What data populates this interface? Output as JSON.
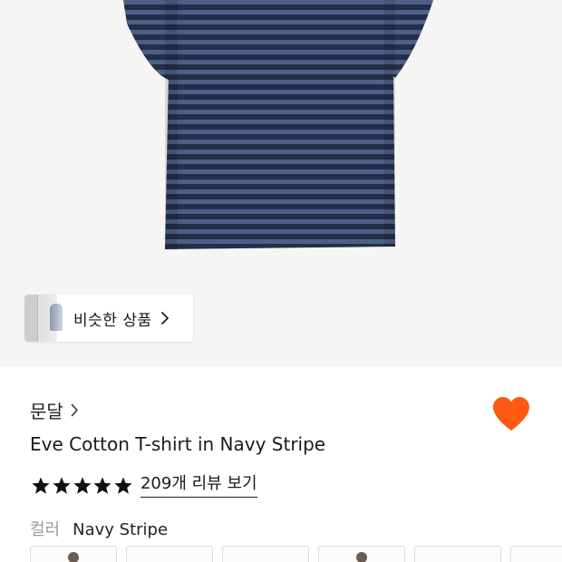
{
  "similar": {
    "label": "비슷한 상품"
  },
  "product": {
    "brand": "문달",
    "title": "Eve Cotton T-shirt in Navy Stripe",
    "favorited": true,
    "accent_color": "#fe5a12",
    "rating": {
      "stars": 5,
      "reviews_label": "209개 리뷰 보기"
    },
    "color": {
      "label": "컬러",
      "value": "Navy Stripe"
    }
  }
}
